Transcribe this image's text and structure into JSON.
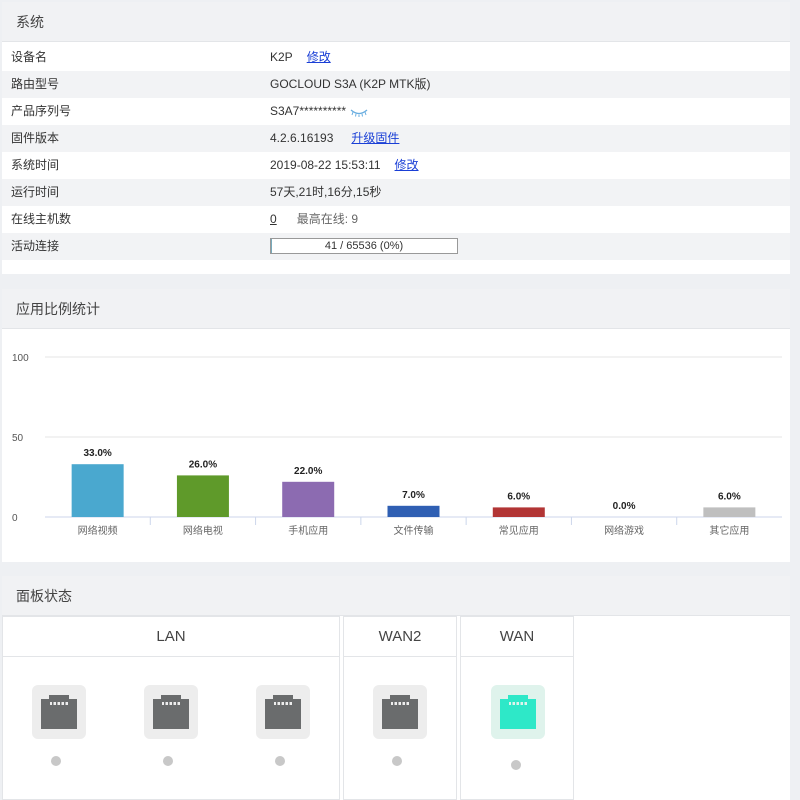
{
  "system": {
    "title": "系统",
    "rows": [
      {
        "label": "设备名",
        "value": "K2P",
        "link": "修改"
      },
      {
        "label": "路由型号",
        "value": "GOCLOUD S3A (K2P MTK版)"
      },
      {
        "label": "产品序列号",
        "value": "S3A7**********"
      },
      {
        "label": "固件版本",
        "value": "4.2.6.16193",
        "link": "升级固件"
      },
      {
        "label": "系统时间",
        "value": "2019-08-22 15:53:11",
        "link": "修改"
      },
      {
        "label": "运行时间",
        "value": "57天,21时,16分,15秒"
      },
      {
        "label": "在线主机数",
        "value": "0",
        "extra": "最高在线:  9"
      },
      {
        "label": "活动连接",
        "value": "41 / 65536 (0%)"
      }
    ],
    "active_connections_fraction": 0.0006
  },
  "chart_panel": {
    "title": "应用比例统计"
  },
  "chart_data": {
    "type": "bar",
    "categories": [
      "网络视频",
      "网络电视",
      "手机应用",
      "文件传输",
      "常见应用",
      "网络游戏",
      "其它应用"
    ],
    "values": [
      33.0,
      26.0,
      22.0,
      7.0,
      6.0,
      0.0,
      6.0
    ],
    "data_labels": [
      "33.0%",
      "26.0%",
      "22.0%",
      "7.0%",
      "6.0%",
      "0.0%",
      "6.0%"
    ],
    "colors": [
      "#4aa8cf",
      "#5f9a2a",
      "#8c6bb1",
      "#2f5fb3",
      "#b23535",
      "#999999",
      "#bfbfbf"
    ],
    "yticks": [
      "100",
      "50",
      "0"
    ],
    "ylim": [
      0,
      100
    ],
    "grid": true
  },
  "ports": {
    "title": "面板状态",
    "groups": [
      {
        "label": "LAN"
      },
      {
        "label": "WAN2"
      },
      {
        "label": "WAN"
      }
    ],
    "port_icon_color": "#6a6c6d",
    "port_active_color": "#2ee8c8"
  }
}
